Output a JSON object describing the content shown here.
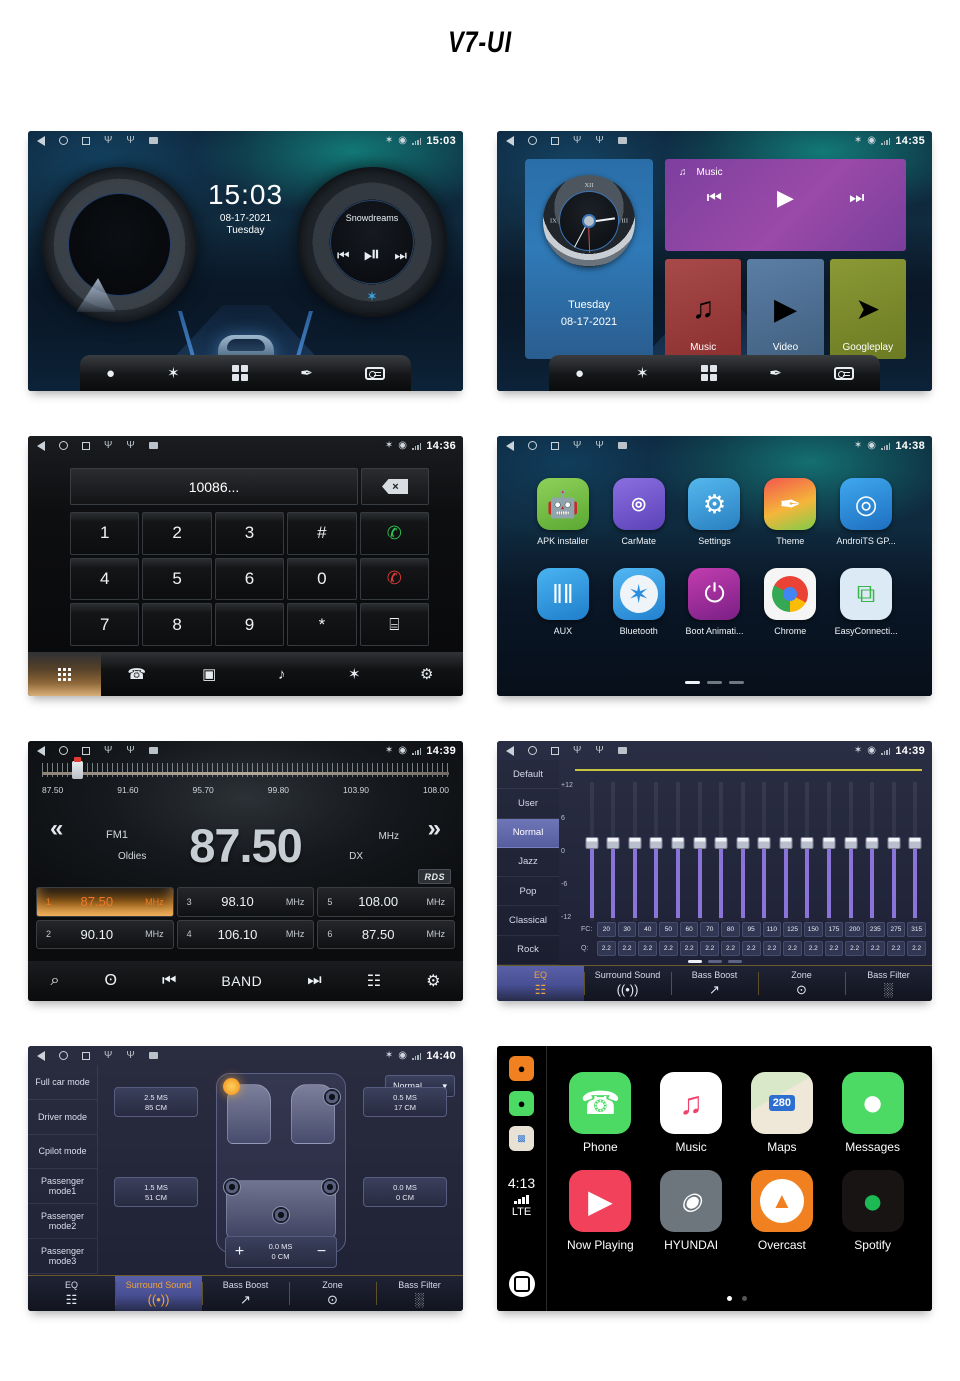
{
  "title": "V7-UI",
  "screens": {
    "home": {
      "status": {
        "time": "15:03",
        "bt": "✶",
        "loc": "◉",
        "icons": [
          "back",
          "home",
          "recents",
          "usb",
          "usb",
          "sd"
        ]
      },
      "clock": {
        "time": "15:03",
        "date": "08-17-2021",
        "weekday": "Tuesday"
      },
      "player": {
        "track": "Snowdreams",
        "prev": "⏮",
        "playpause": "⏯",
        "next": "⏭",
        "bt_label": "✶"
      },
      "dock": [
        "navigation-icon",
        "bluetooth-icon",
        "apps-icon",
        "theme-icon",
        "radio-icon"
      ]
    },
    "widgets": {
      "status": {
        "time": "14:35"
      },
      "clock_widget": {
        "weekday": "Tuesday",
        "date": "08-17-2021",
        "n12": "XII",
        "n3": "III",
        "n9": "IX"
      },
      "music_widget": {
        "label": "Music",
        "note": "♫",
        "prev": "⏮",
        "play": "▶",
        "next": "⏭"
      },
      "tiles": [
        {
          "label": "Music",
          "glyph": "♫",
          "color": "#9c3b3b"
        },
        {
          "label": "Video",
          "glyph": "▶",
          "color": "#4e6f96"
        },
        {
          "label": "Googleplay",
          "glyph": "➤",
          "color": "#7b8a2e"
        }
      ]
    },
    "dialer": {
      "status": {
        "time": "14:36"
      },
      "number": "10086...",
      "delete_label": "⌦",
      "keys": [
        "1",
        "2",
        "3",
        "#",
        "✆",
        "4",
        "5",
        "6",
        "0",
        "✆",
        "7",
        "8",
        "9",
        "*",
        "⌸"
      ],
      "dock": [
        "keypad-icon",
        "call-log-icon",
        "contacts-icon",
        "bt-headset-icon",
        "phone-bt-icon",
        "settings-icon"
      ]
    },
    "apps": {
      "status": {
        "time": "14:38"
      },
      "items": [
        {
          "label": "APK installer",
          "glyph": "ᾑ6",
          "bg": "#6fbe44"
        },
        {
          "label": "CarMate",
          "glyph": "M",
          "bg": "#6a55c8"
        },
        {
          "label": "Settings",
          "glyph": "⚙",
          "bg": "#3aa0e0"
        },
        {
          "label": "Theme",
          "glyph": "✎",
          "bg": "#f0a030"
        },
        {
          "label": "AndroiTS GP...",
          "glyph": "◎",
          "bg": "#2f8fe0"
        },
        {
          "label": "AUX",
          "glyph": "‖",
          "bg": "#34a4ea"
        },
        {
          "label": "Bluetooth",
          "glyph": "✶",
          "bg": "#3ca0e8"
        },
        {
          "label": "Boot Animati...",
          "glyph": "⏻",
          "bg": "#b02a9e"
        },
        {
          "label": "Chrome",
          "glyph": "●",
          "bg": "#f2f2f2"
        },
        {
          "label": "EasyConnecti...",
          "glyph": "⧉",
          "bg": "#d8e8f5"
        }
      ],
      "page_index": 0,
      "page_count": 3
    },
    "radio": {
      "status": {
        "time": "14:39"
      },
      "scale_labels": [
        "87.50",
        "91.60",
        "95.70",
        "99.80",
        "103.90",
        "108.00"
      ],
      "frequency": "87.50",
      "band": "FM1",
      "unit": "MHz",
      "genre": "Oldies",
      "sensitivity": "DX",
      "rds": "RDS",
      "prev_glyph": "«",
      "next_glyph": "»",
      "presets": [
        {
          "no": "1",
          "freq": "87.50",
          "unit": "MHz",
          "selected": true
        },
        {
          "no": "2",
          "freq": "90.10",
          "unit": "MHz",
          "selected": false
        },
        {
          "no": "3",
          "freq": "98.10",
          "unit": "MHz",
          "selected": false
        },
        {
          "no": "4",
          "freq": "106.10",
          "unit": "MHz",
          "selected": false
        },
        {
          "no": "5",
          "freq": "108.00",
          "unit": "MHz",
          "selected": false
        },
        {
          "no": "6",
          "freq": "87.50",
          "unit": "MHz",
          "selected": false
        }
      ],
      "dock": {
        "search": "⌕",
        "scan": "ʘ",
        "prev": "⏮",
        "band_label": "BAND",
        "next": "⏭",
        "eq": "☷",
        "settings": "⚙"
      }
    },
    "equalizer": {
      "status": {
        "time": "14:39"
      },
      "presets": [
        "Default",
        "User",
        "Normal",
        "Jazz",
        "Pop",
        "Classical",
        "Rock"
      ],
      "selected_preset": "Normal",
      "axis_labels": [
        "+12",
        "6",
        "0",
        "-6",
        "-12"
      ],
      "fc_label": "FC:",
      "q_label": "Q:",
      "page_index": 0,
      "page_count": 3,
      "tabs": [
        {
          "label": "EQ",
          "glyph": "☷",
          "active": true
        },
        {
          "label": "Surround Sound",
          "glyph": "((•))",
          "active": false
        },
        {
          "label": "Bass Boost",
          "glyph": "↗",
          "active": false
        },
        {
          "label": "Zone",
          "glyph": "⊙",
          "active": false
        },
        {
          "label": "Bass Filter",
          "glyph": "░",
          "active": false
        }
      ]
    },
    "surround": {
      "status": {
        "time": "14:40"
      },
      "modes": [
        "Full car mode",
        "Driver mode",
        "Cpilot mode",
        "Passenger mode1",
        "Passenger mode2",
        "Passenger mode3"
      ],
      "mode_select": "Normal",
      "delays": {
        "front_left": {
          "ms": "2.5 MS",
          "cm": "85 CM"
        },
        "front_right": {
          "ms": "0.5 MS",
          "cm": "17 CM"
        },
        "rear_left": {
          "ms": "1.5 MS",
          "cm": "51 CM"
        },
        "rear_right": {
          "ms": "0.0 MS",
          "cm": "0 CM"
        },
        "stepper": {
          "ms": "0.0 MS",
          "cm": "0 CM",
          "plus": "+",
          "minus": "−"
        }
      },
      "tabs": [
        {
          "label": "EQ",
          "glyph": "☷",
          "active": false
        },
        {
          "label": "Surround Sound",
          "glyph": "((•))",
          "active": true
        },
        {
          "label": "Bass Boost",
          "glyph": "↗",
          "active": false
        },
        {
          "label": "Zone",
          "glyph": "⊙",
          "active": false
        },
        {
          "label": "Bass Filter",
          "glyph": "░",
          "active": false
        }
      ]
    },
    "carplay": {
      "time": "4:13",
      "network": "LTE",
      "sidebar_apps": [
        "overcast-mini-icon",
        "messages-mini-icon",
        "maps-mini-icon"
      ],
      "apps": [
        {
          "label": "Phone",
          "glyph": "✆",
          "bg": "#4cd964"
        },
        {
          "label": "Music",
          "glyph": "♫",
          "bg": "#ffffff"
        },
        {
          "label": "Maps",
          "glyph": "280",
          "bg": "#e8e2d4"
        },
        {
          "label": "Messages",
          "glyph": "●",
          "bg": "#4cd964"
        },
        {
          "label": "Now Playing",
          "glyph": "▶",
          "bg": "#f2415a"
        },
        {
          "label": "HYUNDAI",
          "glyph": "H",
          "bg": "#6d757d"
        },
        {
          "label": "Overcast",
          "glyph": "●",
          "bg": "#f08020"
        },
        {
          "label": "Spotify",
          "glyph": "≡",
          "bg": "#1a1a1a"
        }
      ],
      "page_index": 0,
      "page_count": 2
    }
  }
}
